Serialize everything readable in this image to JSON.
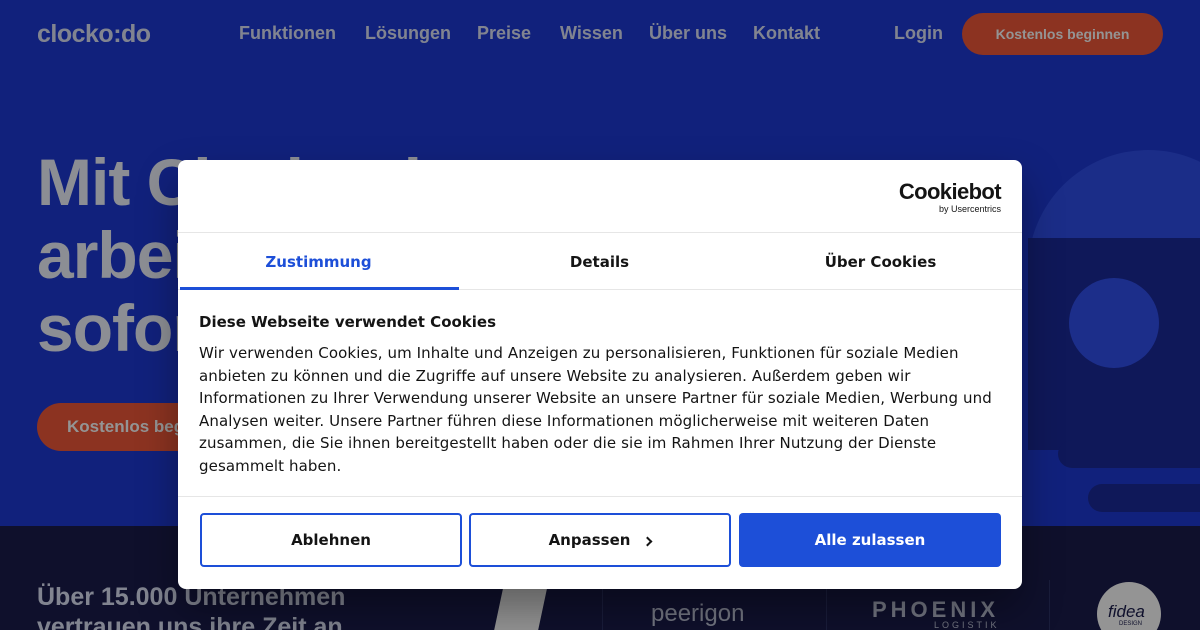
{
  "header": {
    "logo": "clocko:do",
    "nav": [
      "Funktionen",
      "Lösungen",
      "Preise",
      "Wissen",
      "Über uns",
      "Kontakt"
    ],
    "login": "Login",
    "cta": "Kostenlos beginnen"
  },
  "hero": {
    "headline_lines": [
      "Mit Clocko:do",
      "arbeiten Sie",
      "sofort"
    ],
    "cta": "Kostenlos beginnen"
  },
  "trust": {
    "lines": [
      "Über 15.000 Unternehmen",
      "vertrauen uns ihre Zeit an"
    ],
    "partners": [
      "peerigon",
      "PHOENIX",
      "LOGISTIK",
      "fidea",
      "DESIGN"
    ]
  },
  "colors": {
    "hero_bg": "#1e3ad6",
    "band_bg": "#1a1d4c",
    "cta_orange": "#f2593a",
    "accent_blue": "#1d4fd8"
  },
  "cookie_dialog": {
    "brand": "Cookiebot",
    "brand_sub": "by Usercentrics",
    "tabs": [
      {
        "label": "Zustimmung",
        "active": true
      },
      {
        "label": "Details",
        "active": false
      },
      {
        "label": "Über Cookies",
        "active": false
      }
    ],
    "title": "Diese Webseite verwendet Cookies",
    "text_lines": [
      "Wir verwenden Cookies, um Inhalte und Anzeigen zu personalisieren, Funktionen für soziale Medien",
      "anbieten zu können und die Zugriffe auf unsere Website zu analysieren. Außerdem geben wir",
      "Informationen zu Ihrer Verwendung unserer Website an unsere Partner für soziale Medien, Werbung und",
      "Analysen weiter. Unsere Partner führen diese Informationen möglicherweise mit weiteren Daten",
      "zusammen, die Sie ihnen bereitgestellt haben oder die sie im Rahmen Ihrer Nutzung der Dienste",
      "gesammelt haben."
    ],
    "buttons": {
      "decline": "Ablehnen",
      "customize": "Anpassen",
      "accept_all": "Alle zulassen"
    }
  }
}
